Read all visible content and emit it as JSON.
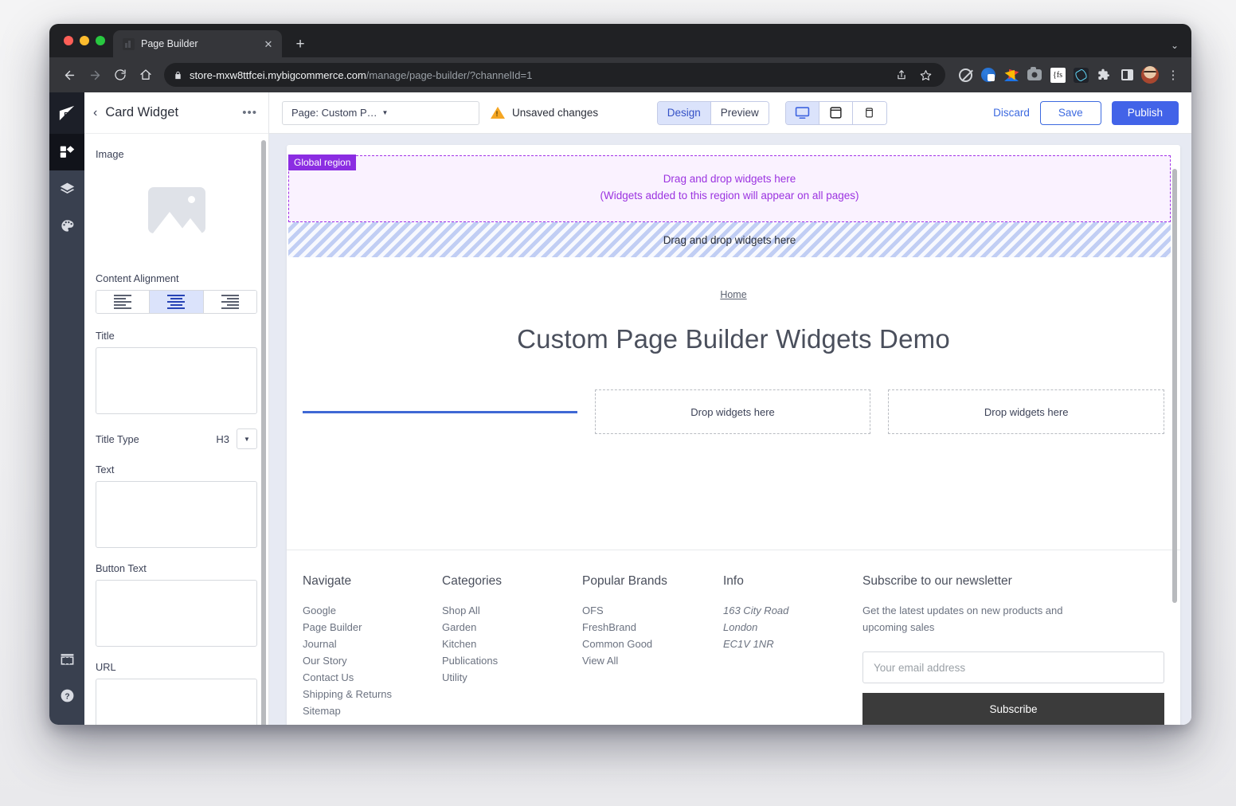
{
  "browser": {
    "tab_title": "Page Builder",
    "tab_close": "✕",
    "new_tab": "+",
    "window_menu": "⌄",
    "url_host": "store-mxw8ttfcei.mybigcommerce.com",
    "url_path": "/manage/page-builder/?channelId=1",
    "extensions": [
      "block-icon",
      "adblock-icon",
      "drive-icon",
      "camera-icon",
      "fs-icon",
      "react-icon",
      "puzzle-icon",
      "sidepanel-icon",
      "profile-avatar",
      "kebab-menu-icon"
    ]
  },
  "rail": {
    "logo": "bigcommerce-logo",
    "items": [
      {
        "name": "widgets-icon",
        "active": true
      },
      {
        "name": "layers-icon",
        "active": false
      },
      {
        "name": "theme-palette-icon",
        "active": false
      },
      {
        "name": "storefront-icon",
        "active": false
      },
      {
        "name": "help-icon",
        "active": false
      }
    ]
  },
  "sidebar": {
    "back": "‹",
    "title": "Card Widget",
    "more": "•••",
    "fields": {
      "image_label": "Image",
      "content_alignment_label": "Content Alignment",
      "alignment_options": [
        "left",
        "center",
        "right"
      ],
      "alignment_selected": "center",
      "title_label": "Title",
      "title_value": "",
      "title_type_label": "Title Type",
      "title_type_value": "H3",
      "text_label": "Text",
      "text_value": "",
      "button_text_label": "Button Text",
      "button_text_value": "",
      "url_label": "URL"
    }
  },
  "toolbar": {
    "page_select": "Page: Custom Page Builder Widge...",
    "page_select_caret": "▼",
    "unsaved": "Unsaved changes",
    "mode_design": "Design",
    "mode_preview": "Preview",
    "mode_selected": "Design",
    "devices": [
      "desktop",
      "tablet",
      "mobile"
    ],
    "device_selected": "desktop",
    "discard": "Discard",
    "save": "Save",
    "publish": "Publish"
  },
  "canvas": {
    "global_region_badge": "Global region",
    "global_region_line1": "Drag and drop widgets here",
    "global_region_line2": "(Widgets added to this region will appear on all pages)",
    "header_dropzone": "Drag and drop widgets here",
    "breadcrumb": "Home",
    "page_title": "Custom Page Builder Widgets Demo",
    "drop_zone_2": "Drop widgets here",
    "drop_zone_3": "Drop widgets here"
  },
  "footer": {
    "columns": [
      {
        "heading": "Navigate",
        "links": [
          "Google",
          "Page Builder",
          "Journal",
          "Our Story",
          "Contact Us",
          "Shipping & Returns",
          "Sitemap"
        ]
      },
      {
        "heading": "Categories",
        "links": [
          "Shop All",
          "Garden",
          "Kitchen",
          "Publications",
          "Utility"
        ]
      },
      {
        "heading": "Popular Brands",
        "links": [
          "OFS",
          "FreshBrand",
          "Common Good",
          "View All"
        ]
      },
      {
        "heading": "Info",
        "links": [
          "163 City Road",
          "London",
          "EC1V 1NR"
        ]
      }
    ],
    "newsletter": {
      "heading": "Subscribe to our newsletter",
      "description": "Get the latest updates on new products and upcoming sales",
      "email_placeholder": "Your email address",
      "subscribe_label": "Subscribe"
    }
  },
  "colors": {
    "accent_blue": "#4263e8",
    "global_region_purple": "#8b2de2",
    "rail_dark": "#39404f",
    "warning_amber": "#f5a623"
  }
}
